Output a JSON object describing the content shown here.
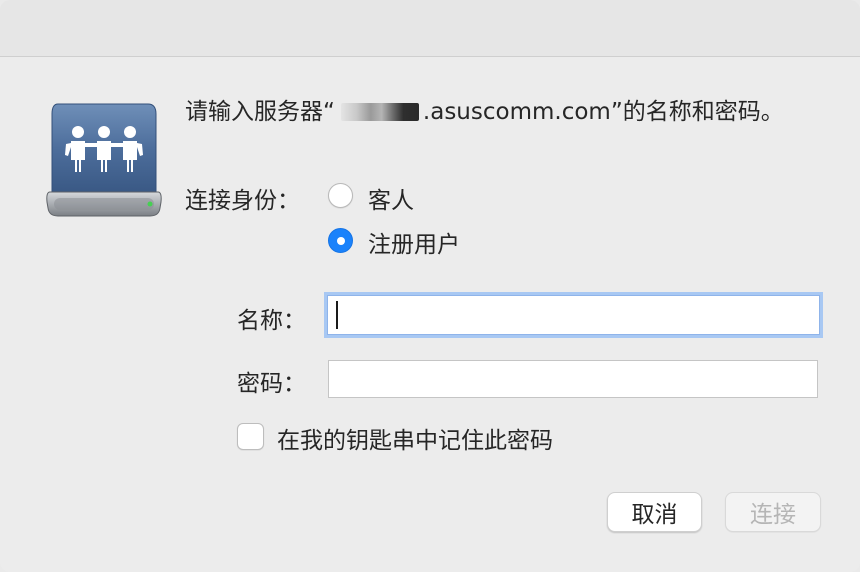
{
  "dialog": {
    "prompt_prefix": "请输入服务器“",
    "prompt_suffix": ".asuscomm.com”的名称和密码。",
    "icon": "shared-server-icon"
  },
  "connect_as": {
    "label": "连接身份：",
    "options": [
      {
        "label": "客人",
        "selected": false
      },
      {
        "label": "注册用户",
        "selected": true
      }
    ]
  },
  "form": {
    "name_label": "名称：",
    "name_value": "",
    "password_label": "密码：",
    "password_value": ""
  },
  "keychain": {
    "label": "在我的钥匙串中记住此密码",
    "checked": false
  },
  "buttons": {
    "cancel": "取消",
    "connect": "连接"
  },
  "colors": {
    "accent": "#1a82fb",
    "focus_ring": "#a8c8f3",
    "disabled_text": "#b5b5b5"
  }
}
